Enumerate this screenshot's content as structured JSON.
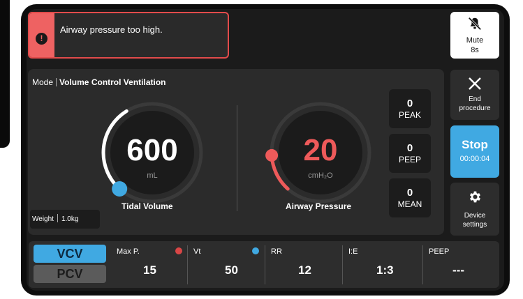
{
  "alarm": {
    "message": "Airway pressure too high."
  },
  "mute": {
    "label": "Mute",
    "time": "8s",
    "icon": "bell-off-icon"
  },
  "mode": {
    "label": "Mode",
    "value": "Volume Control Ventilation"
  },
  "tidal_volume": {
    "value": "600",
    "unit": "mL",
    "title": "Tidal Volume",
    "fill_fraction": 0.38
  },
  "airway_pressure": {
    "value": "20",
    "unit": "cmH₂O",
    "title": "Airway Pressure",
    "fill_fraction": 0.16
  },
  "stats": [
    {
      "value": "0",
      "label": "PEAK"
    },
    {
      "value": "0",
      "label": "PEEP"
    },
    {
      "value": "0",
      "label": "MEAN"
    }
  ],
  "weight": {
    "label": "Weight",
    "value": "1.0kg"
  },
  "end_procedure": {
    "label_line1": "End",
    "label_line2": "procedure"
  },
  "stop": {
    "label": "Stop",
    "time": "00:00:04"
  },
  "device_settings": {
    "label_line1": "Device",
    "label_line2": "settings"
  },
  "modes": {
    "vcv": "VCV",
    "pcv": "PCV",
    "selected": "VCV"
  },
  "params": [
    {
      "label": "Max P.",
      "value": "15"
    },
    {
      "label": "Vt",
      "value": "50"
    },
    {
      "label": "RR",
      "value": "12"
    },
    {
      "label": "I:E",
      "value": "1:3"
    },
    {
      "label": "PEEP",
      "value": "---"
    }
  ],
  "colors": {
    "accent_blue": "#40a9e2",
    "alarm_red": "#e24b4b",
    "pressure_red": "#ee5a5a"
  }
}
